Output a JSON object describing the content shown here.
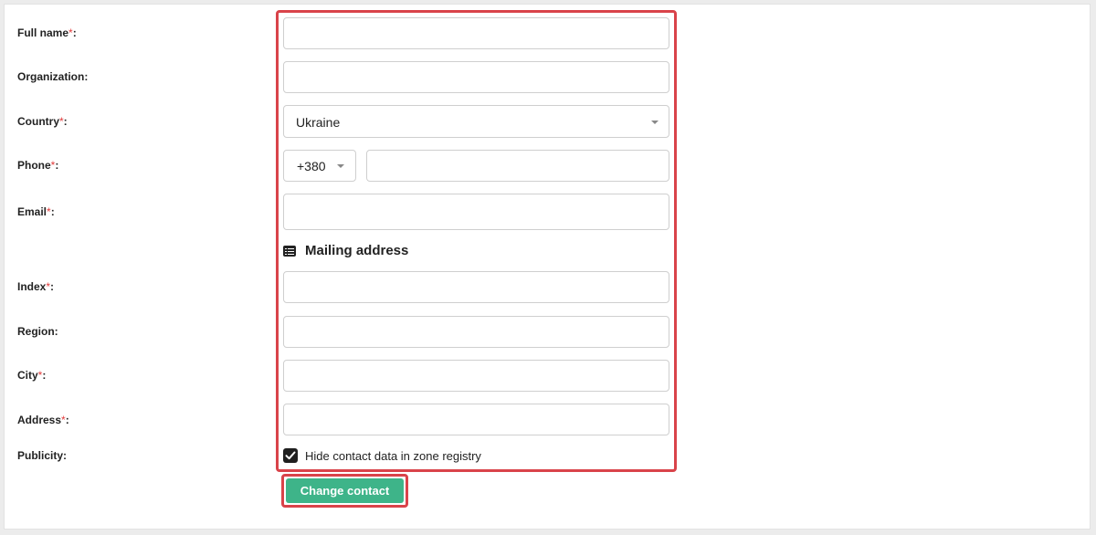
{
  "form": {
    "full_name": {
      "label": "Full name",
      "required": "*",
      "colon": ":",
      "value": ""
    },
    "organization": {
      "label": "Organization:",
      "value": ""
    },
    "country": {
      "label": "Country",
      "required": "*",
      "colon": ":",
      "value": "Ukraine"
    },
    "phone": {
      "label": "Phone",
      "required": "*",
      "colon": ":",
      "code": "+380",
      "value": ""
    },
    "email": {
      "label": "Email",
      "required": "*",
      "colon": ":",
      "value": ""
    },
    "mailing_section": {
      "title": "Mailing address",
      "icon": "list-icon"
    },
    "index": {
      "label": "Index",
      "required": "*",
      "colon": ":",
      "value": ""
    },
    "region": {
      "label": "Region:",
      "value": ""
    },
    "city": {
      "label": "City",
      "required": "*",
      "colon": ":",
      "value": ""
    },
    "address": {
      "label": "Address",
      "required": "*",
      "colon": ":",
      "value": ""
    },
    "publicity": {
      "label": "Publicity:",
      "checkbox_label": "Hide contact data in zone registry",
      "checked": true
    }
  },
  "actions": {
    "submit_label": "Change contact"
  },
  "colors": {
    "accent": "#3eb489",
    "highlight": "#d9434a",
    "required": "#e23b3b"
  }
}
